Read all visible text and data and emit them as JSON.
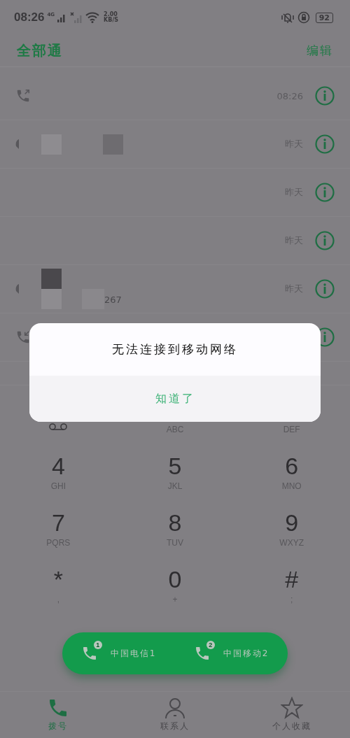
{
  "status_bar": {
    "time": "08:26",
    "network": "4G",
    "speed_value": "2.00",
    "speed_unit": "KB/S",
    "battery": "92"
  },
  "header": {
    "title": "全部通",
    "action": "编辑"
  },
  "calls": [
    {
      "kind": "outgoing",
      "time": "08:26"
    },
    {
      "kind": "partial",
      "name": {
        "kind": "redacted"
      },
      "time": "昨天"
    },
    {
      "kind": "none",
      "time": "昨天"
    },
    {
      "kind": "none",
      "time": "昨天"
    },
    {
      "kind": "partial",
      "name": {
        "kind": "redacted",
        "number": "267"
      },
      "time": "昨天"
    },
    {
      "kind": "incoming"
    }
  ],
  "keypad": [
    [
      {
        "kind": "voicemail"
      },
      {
        "letters": "ABC"
      },
      {
        "letters": "DEF"
      }
    ],
    [
      {
        "digit": "4",
        "letters": "GHI"
      },
      {
        "digit": "5",
        "letters": "JKL"
      },
      {
        "digit": "6",
        "letters": "MNO"
      }
    ],
    [
      {
        "digit": "7",
        "letters": "PQRS"
      },
      {
        "digit": "8",
        "letters": "TUV"
      },
      {
        "digit": "9",
        "letters": "WXYZ"
      }
    ],
    [
      {
        "digit": "*",
        "letters": ","
      },
      {
        "digit": "0",
        "letters": "+"
      },
      {
        "digit": "#",
        "letters": ";"
      }
    ]
  ],
  "sims": [
    {
      "slot": "1",
      "label": "中国电信1"
    },
    {
      "slot": "2",
      "label": "中国移动2"
    }
  ],
  "nav": [
    {
      "kind": "phone",
      "label": "拨号",
      "selected": true
    },
    {
      "kind": "person",
      "label": "联系人",
      "selected": false
    },
    {
      "kind": "star",
      "label": "个人收藏",
      "selected": false
    }
  ],
  "dialog": {
    "message": "无法连接到移动网络",
    "button": "知道了"
  }
}
